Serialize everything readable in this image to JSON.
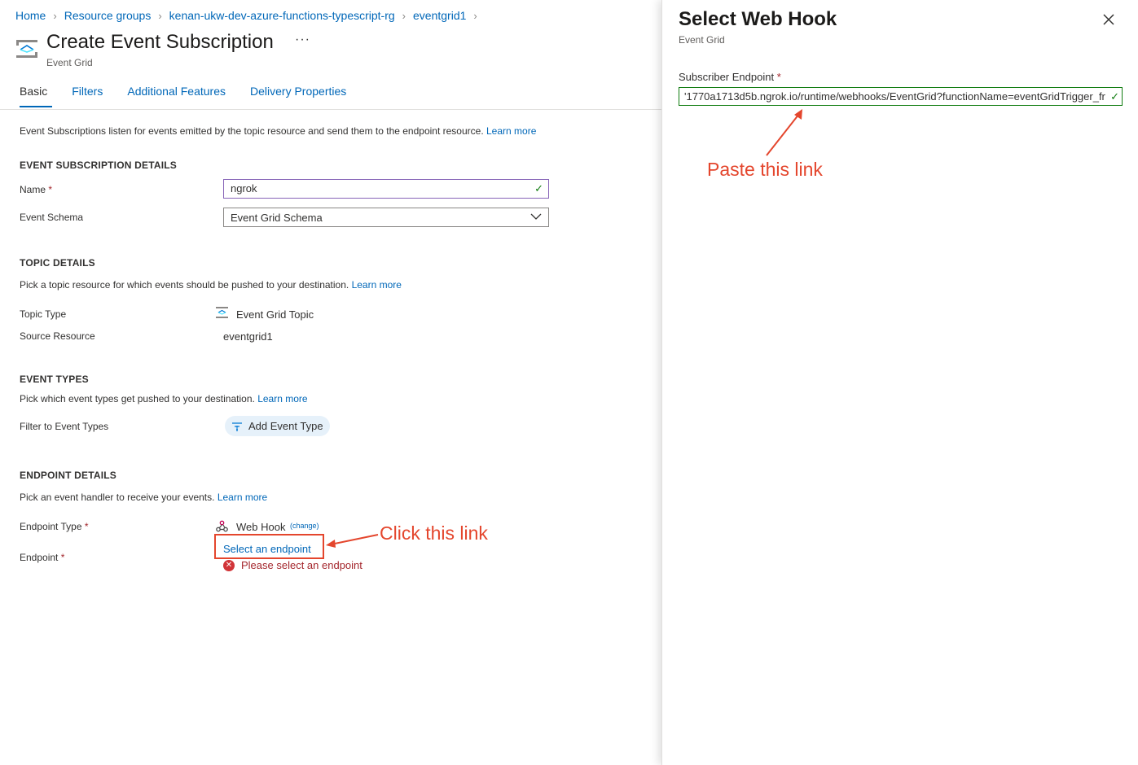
{
  "breadcrumb": {
    "items": [
      "Home",
      "Resource groups",
      "kenan-ukw-dev-azure-functions-typescript-rg",
      "eventgrid1"
    ]
  },
  "header": {
    "title": "Create Event Subscription",
    "subtitle": "Event Grid",
    "more": "···"
  },
  "tabs": [
    "Basic",
    "Filters",
    "Additional Features",
    "Delivery Properties"
  ],
  "intro": {
    "text": "Event Subscriptions listen for events emitted by the topic resource and send them to the endpoint resource.",
    "learn_more": "Learn more"
  },
  "event_subscription_details": {
    "heading": "EVENT SUBSCRIPTION DETAILS",
    "name_label": "Name",
    "name_value": "ngrok",
    "schema_label": "Event Schema",
    "schema_value": "Event Grid Schema"
  },
  "topic_details": {
    "heading": "TOPIC DETAILS",
    "desc": "Pick a topic resource for which events should be pushed to your destination.",
    "learn_more": "Learn more",
    "topic_type_label": "Topic Type",
    "topic_type_value": "Event Grid Topic",
    "source_label": "Source Resource",
    "source_value": "eventgrid1"
  },
  "event_types": {
    "heading": "EVENT TYPES",
    "desc": "Pick which event types get pushed to your destination.",
    "learn_more": "Learn more",
    "filter_label": "Filter to Event Types",
    "add_button": "Add Event Type"
  },
  "endpoint_details": {
    "heading": "ENDPOINT DETAILS",
    "desc": "Pick an event handler to receive your events.",
    "learn_more": "Learn more",
    "type_label": "Endpoint Type",
    "type_value": "Web Hook",
    "change": "(change)",
    "endpoint_label": "Endpoint",
    "select_link": "Select an endpoint",
    "error": "Please select an endpoint"
  },
  "annotations": {
    "click": "Click this link",
    "paste": "Paste this link"
  },
  "blade": {
    "title": "Select Web Hook",
    "subtitle": "Event Grid",
    "endpoint_label": "Subscriber Endpoint",
    "endpoint_value": "'1770a1713d5b.ngrok.io/runtime/webhooks/EventGrid?functionName=eventGridTrigger_fr"
  },
  "required_marker": "*",
  "colors": {
    "link": "#0067b8",
    "annotation": "#e4462d",
    "error": "#a4262c",
    "success": "#107c10"
  }
}
